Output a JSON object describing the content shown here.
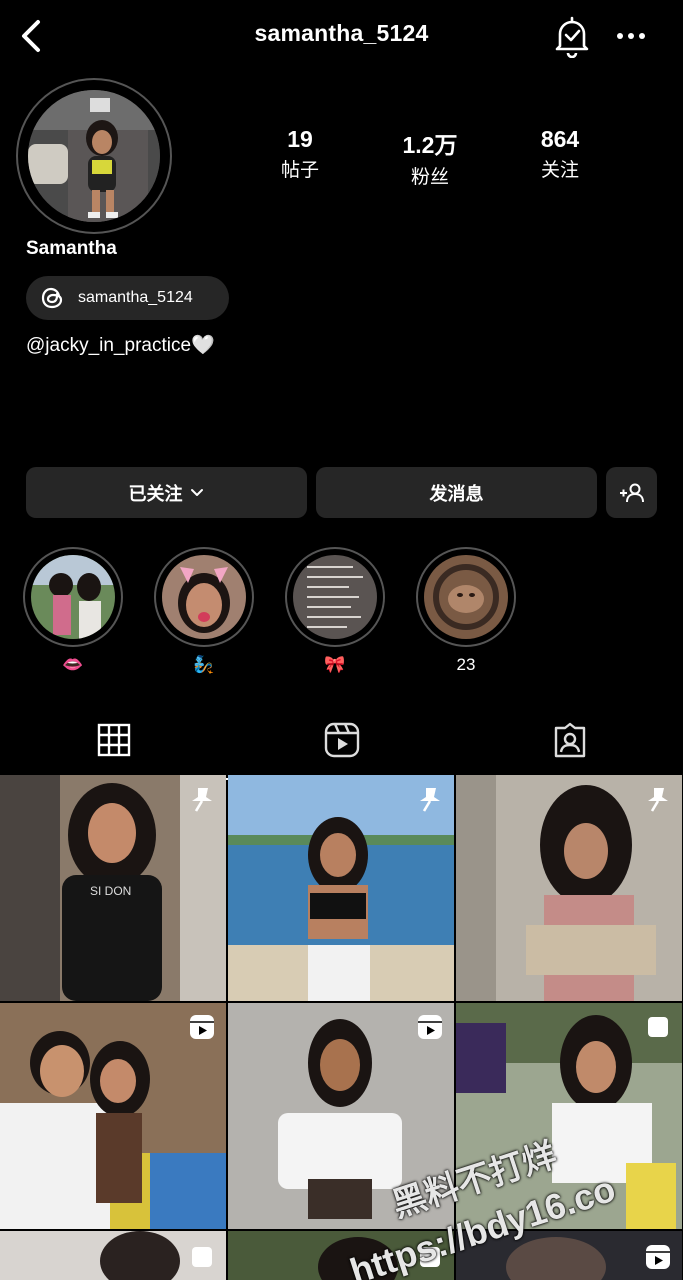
{
  "header": {
    "username": "samantha_5124",
    "back_icon": "chevron-left-icon",
    "bell_icon": "bell-check-icon",
    "more_icon": "more-horizontal-icon"
  },
  "profile": {
    "display_name": "Samantha",
    "threads_handle": "samantha_5124",
    "bio": "@jacky_in_practice🤍",
    "stats": [
      {
        "num": "19",
        "label": "帖子"
      },
      {
        "num": "1.2万",
        "label": "粉丝"
      },
      {
        "num": "864",
        "label": "关注"
      }
    ]
  },
  "actions": {
    "follow_label": "已关注",
    "message_label": "发消息"
  },
  "highlights": [
    {
      "label": "👄"
    },
    {
      "label": "🧞"
    },
    {
      "label": "🎀"
    },
    {
      "label": "23"
    }
  ],
  "tabs": [
    "grid-icon",
    "reels-icon",
    "tagged-icon"
  ],
  "watermark": {
    "line1": "黑料不打烊",
    "line2": "https://bdy16.co"
  },
  "colors": {
    "background": "#000000",
    "button_bg": "#262626",
    "ring": "#555555"
  }
}
